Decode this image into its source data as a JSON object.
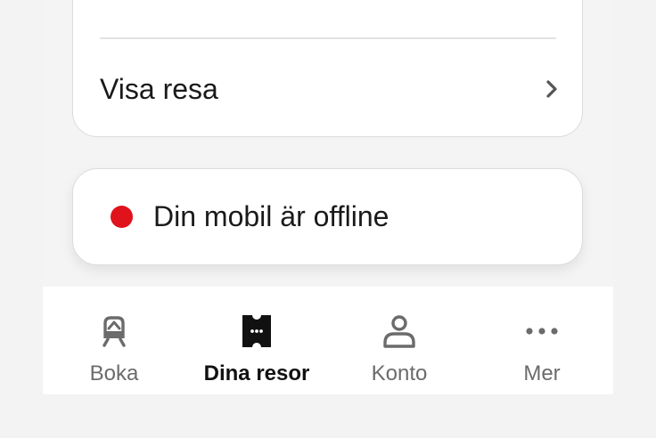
{
  "trip_card": {
    "view_trip_label": "Visa resa",
    "chevron_icon": "chevron-right-icon"
  },
  "status": {
    "offline_message": "Din mobil är offline",
    "indicator_color": "#e0121b"
  },
  "bottom_nav": {
    "active_index": 1,
    "items": [
      {
        "label": "Boka",
        "icon": "train-icon"
      },
      {
        "label": "Dina resor",
        "icon": "ticket-icon"
      },
      {
        "label": "Konto",
        "icon": "person-icon"
      },
      {
        "label": "Mer",
        "icon": "more-icon"
      }
    ]
  },
  "colors": {
    "accent": "#e0121b",
    "text": "#1a1a1a",
    "inactive_nav": "#6b6b6b",
    "active_nav": "#111111"
  }
}
